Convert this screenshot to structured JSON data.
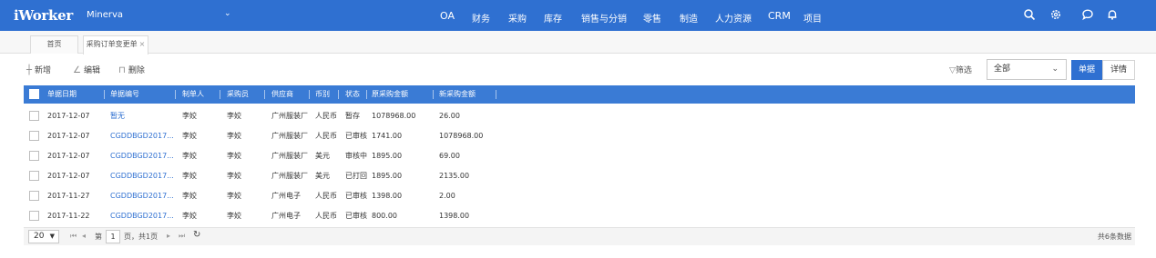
{
  "app": {
    "logo": "iWorker",
    "company": "Minerva",
    "company_caret": "⌄"
  },
  "nav": {
    "items": [
      {
        "label": "OA",
        "latin": true
      },
      {
        "label": "财务",
        "latin": false
      },
      {
        "label": "采购",
        "latin": false
      },
      {
        "label": "库存",
        "latin": false
      },
      {
        "label": "销售与分销",
        "latin": false
      },
      {
        "label": "零售",
        "latin": false
      },
      {
        "label": "制造",
        "latin": false
      },
      {
        "label": "人力资源",
        "latin": false
      },
      {
        "label": "CRM",
        "latin": true
      },
      {
        "label": "项目",
        "latin": false
      }
    ],
    "icons": [
      "search-icon",
      "gear-icon",
      "chat-icon",
      "bell-icon"
    ]
  },
  "tabs": [
    {
      "label": "首页",
      "closable": false
    },
    {
      "label": "采购订单变更单",
      "closable": true,
      "close": "×"
    }
  ],
  "toolbar": {
    "add_label": "新增",
    "edit_label": "编辑",
    "delete_label": "删除",
    "filter_label": "筛选",
    "filter_value": "全部",
    "doc_label": "单据",
    "detail_label": "详情"
  },
  "table": {
    "columns": [
      "单据日期",
      "单据编号",
      "制单人",
      "采购员",
      "供应商",
      "币别",
      "状态",
      "原采购金额",
      "新采购金额"
    ],
    "rows": [
      [
        "2017-12-07",
        "暂无",
        "李姣",
        "李姣",
        "广州服装厂",
        "人民币",
        "暂存",
        "1078968.00",
        "26.00"
      ],
      [
        "2017-12-07",
        "CGDDBGD2017...",
        "李姣",
        "李姣",
        "广州服装厂",
        "人民币",
        "已审核",
        "1741.00",
        "1078968.00"
      ],
      [
        "2017-12-07",
        "CGDDBGD2017...",
        "李姣",
        "李姣",
        "广州服装厂",
        "美元",
        "审核中",
        "1895.00",
        "69.00"
      ],
      [
        "2017-12-07",
        "CGDDBGD2017...",
        "李姣",
        "李姣",
        "广州服装厂",
        "美元",
        "已打回",
        "1895.00",
        "2135.00"
      ],
      [
        "2017-11-27",
        "CGDDBGD2017...",
        "李姣",
        "李姣",
        "广州电子",
        "人民币",
        "已审核",
        "1398.00",
        "2.00"
      ],
      [
        "2017-11-22",
        "CGDDBGD2017...",
        "李姣",
        "李姣",
        "广州电子",
        "人民币",
        "已审核",
        "800.00",
        "1398.00"
      ]
    ]
  },
  "pager": {
    "page_size": "20",
    "page_label_prefix": "第",
    "current_page": "1",
    "page_label_suffix": "页，共1页",
    "total": "共6条数据"
  },
  "colors": {
    "primary": "#2f70d1",
    "header": "#3a7bd5",
    "link": "#2f70d1"
  }
}
